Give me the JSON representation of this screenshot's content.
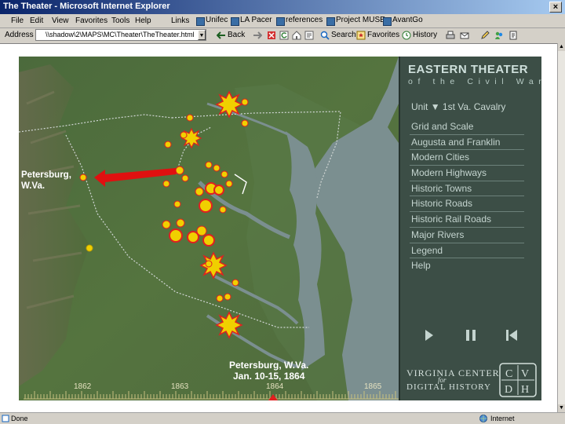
{
  "window": {
    "title": "The Theater - Microsoft Internet Explorer",
    "close": "×"
  },
  "menubar": {
    "items": [
      "File",
      "Edit",
      "View",
      "Favorites",
      "Tools",
      "Help"
    ],
    "links_label": "Links",
    "links": [
      "Unifec",
      "LA Pacer",
      "references",
      "Project MUSE",
      "AvantGo"
    ]
  },
  "address_bar": {
    "label": "Address",
    "value": "\\\\shadow\\2\\MAPS\\MC\\Theater\\TheTheater.html",
    "buttons": [
      "Back",
      "Search",
      "Favorites",
      "History"
    ]
  },
  "map": {
    "place_label": [
      "Petersburg,",
      "W.Va."
    ],
    "caption": [
      "Petersburg, W.Va.",
      "Jan. 10-15, 1864"
    ],
    "timeline_years": [
      "1862",
      "1863",
      "1864",
      "1865"
    ],
    "colors": {
      "marker": "#f0d000",
      "burst": "#e02020",
      "arrow": "#e01010"
    }
  },
  "panel": {
    "title_line1": "EASTERN THEATER",
    "title_line2": "of the Civil War",
    "unit_prefix": "Unit",
    "unit_arrow": "▼",
    "unit_name": "1st Va. Cavalry",
    "menu": [
      "Grid and Scale",
      "Augusta and Franklin",
      "Modern Cities",
      "Modern Highways",
      "Historic Towns",
      "Historic Roads",
      "Historic Rail Roads",
      "Major Rivers",
      "Legend",
      "Help"
    ],
    "logo": {
      "line1": "VIRGINIA CENTER",
      "for": "for",
      "line2": "DIGITAL HISTORY",
      "seal": [
        "C",
        "V",
        "D",
        "H"
      ]
    }
  },
  "status": {
    "left": "Done",
    "right": "Internet"
  }
}
